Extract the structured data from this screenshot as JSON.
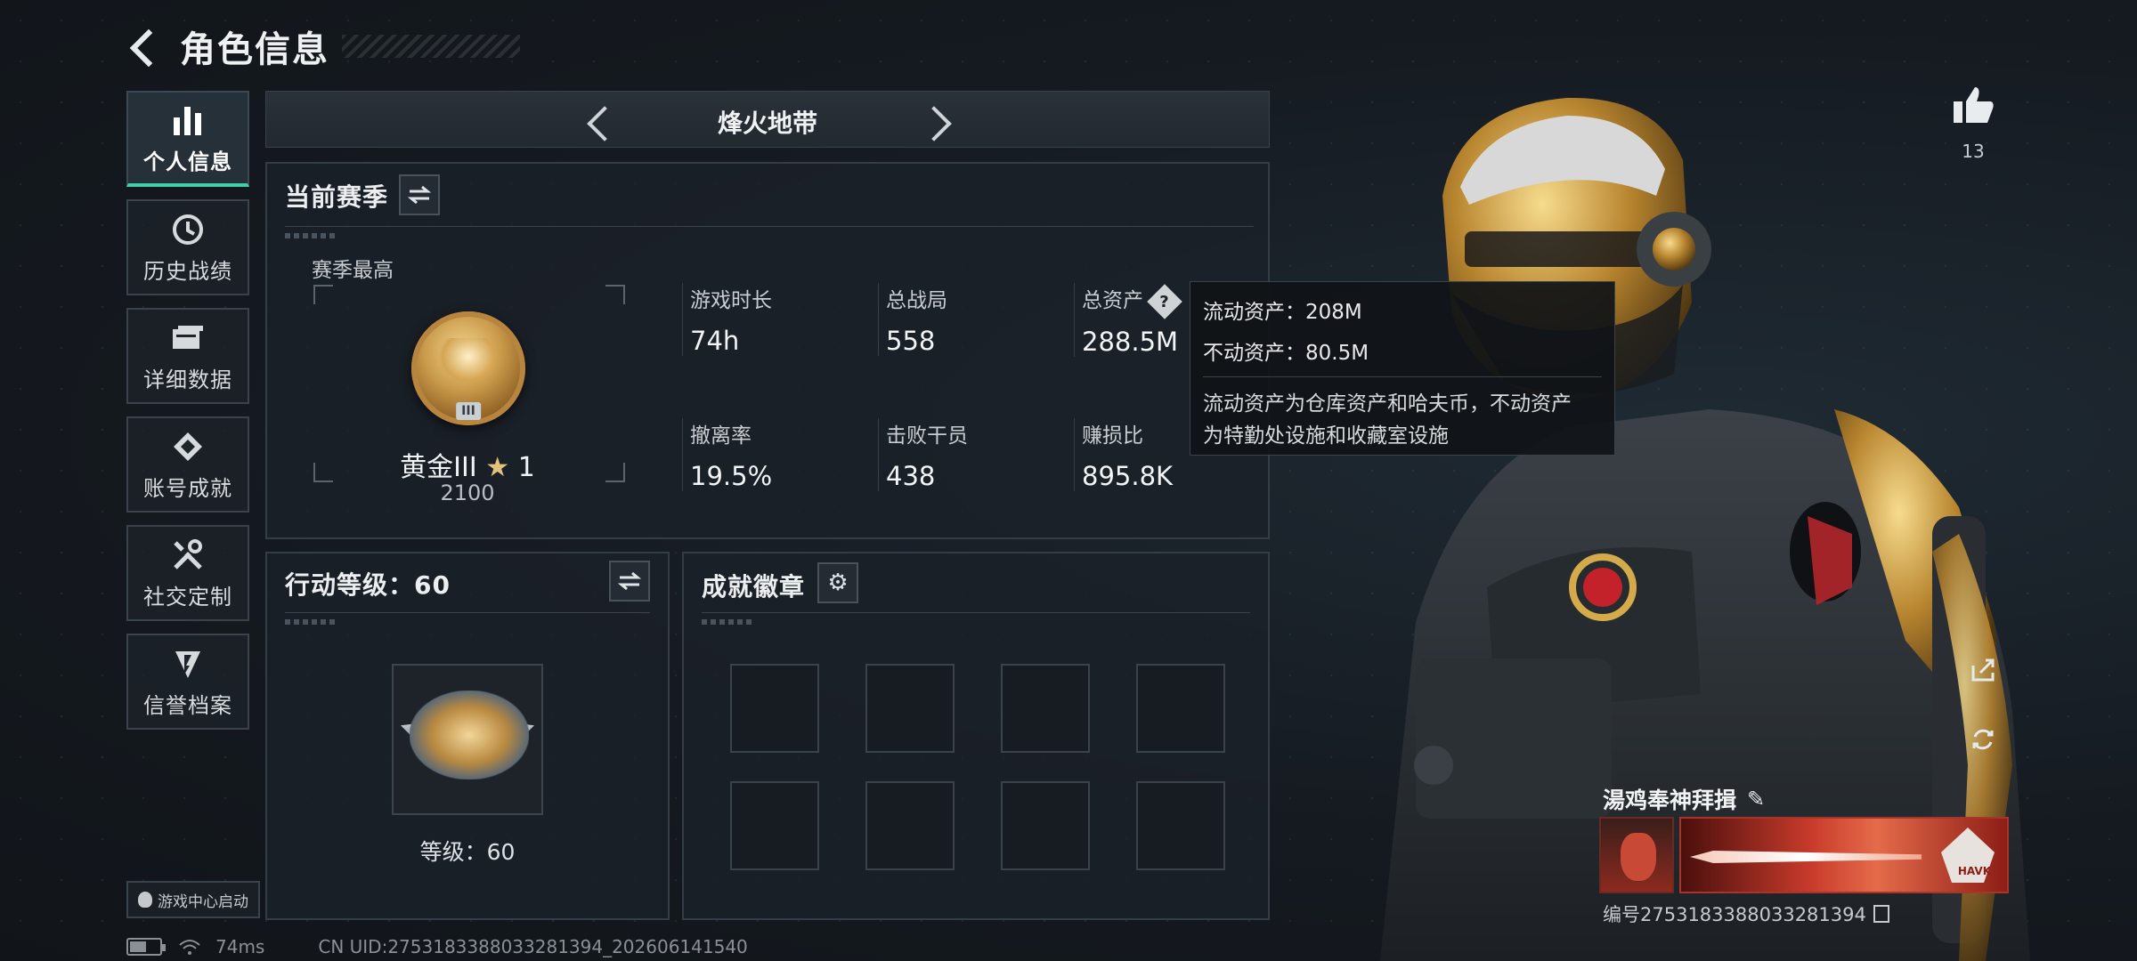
{
  "header": {
    "title": "角色信息"
  },
  "sidebar": {
    "items": [
      {
        "label": "个人信息",
        "icon": "bar-chart-icon",
        "active": true
      },
      {
        "label": "历史战绩",
        "icon": "history-icon"
      },
      {
        "label": "详细数据",
        "icon": "folder-icon"
      },
      {
        "label": "账号成就",
        "icon": "achievement-icon"
      },
      {
        "label": "社交定制",
        "icon": "tools-icon"
      },
      {
        "label": "信誉档案",
        "icon": "credit-icon"
      }
    ],
    "launch_label": "游戏中心启动"
  },
  "status": {
    "ping": "74ms",
    "uid": "CN UID:2753183388033281394_202606141540"
  },
  "mode": {
    "title": "烽火地带"
  },
  "season": {
    "title": "当前赛季",
    "best_label": "赛季最高",
    "rank_name": "黄金III",
    "rank_stars": "1",
    "rank_score": "2100",
    "stats": [
      {
        "label": "游戏时长",
        "value": "74h"
      },
      {
        "label": "总战局",
        "value": "558"
      },
      {
        "label": "总资产",
        "value": "288.5M"
      },
      {
        "label": "撤离率",
        "value": "19.5%"
      },
      {
        "label": "击败干员",
        "value": "438"
      },
      {
        "label": "赚损比",
        "value": "895.8K"
      }
    ]
  },
  "tooltip": {
    "liquid": "流动资产：208M",
    "fixed": "不动资产：80.5M",
    "desc1": "流动资产为仓库资产和哈夫币，不动资产",
    "desc2": "为特勤处设施和收藏室设施"
  },
  "action_level": {
    "title": "行动等级：60",
    "level_text": "等级：60"
  },
  "achievements": {
    "title": "成就徽章",
    "slot_count": 8
  },
  "social": {
    "likes": "13"
  },
  "player": {
    "name": "湯鸡奉神拜揖",
    "id": "编号2753183388033281394",
    "banner_brand": "HAVK"
  },
  "colors": {
    "accent": "#3fd0a8",
    "panel_border": "#343c45",
    "background": "#161b22"
  }
}
